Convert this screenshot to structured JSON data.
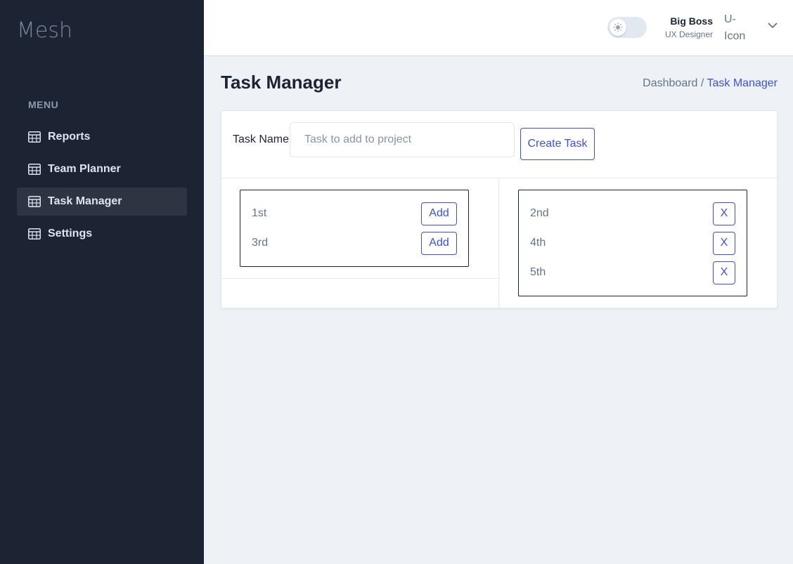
{
  "app": {
    "logo": "Mesh"
  },
  "sidebar": {
    "menu_label": "MENU",
    "items": [
      {
        "label": "Reports",
        "icon": "calendar-icon"
      },
      {
        "label": "Team Planner",
        "icon": "calendar-icon"
      },
      {
        "label": "Task Manager",
        "icon": "calendar-icon",
        "active": true
      },
      {
        "label": "Settings",
        "icon": "calendar-icon"
      }
    ]
  },
  "header": {
    "theme_toggle": "sun-icon",
    "user_name": "Big Boss",
    "user_role": "UX Designer",
    "avatar_alt": "U-Icon"
  },
  "page": {
    "title": "Task Manager",
    "breadcrumb": {
      "parent": "Dashboard /",
      "current": "Task Manager"
    }
  },
  "form": {
    "label": "Task Name:",
    "placeholder": "Task to add to project",
    "create_label": "Create Task"
  },
  "lists": {
    "available": [
      {
        "name": "1st",
        "action": "Add"
      },
      {
        "name": "3rd",
        "action": "Add"
      }
    ],
    "project": [
      {
        "name": "2nd",
        "action": "X"
      },
      {
        "name": "4th",
        "action": "X"
      },
      {
        "name": "5th",
        "action": "X"
      }
    ]
  },
  "colors": {
    "sidebar": "#1c2434",
    "accent": "#3c50e0",
    "background": "#eef1f5"
  }
}
